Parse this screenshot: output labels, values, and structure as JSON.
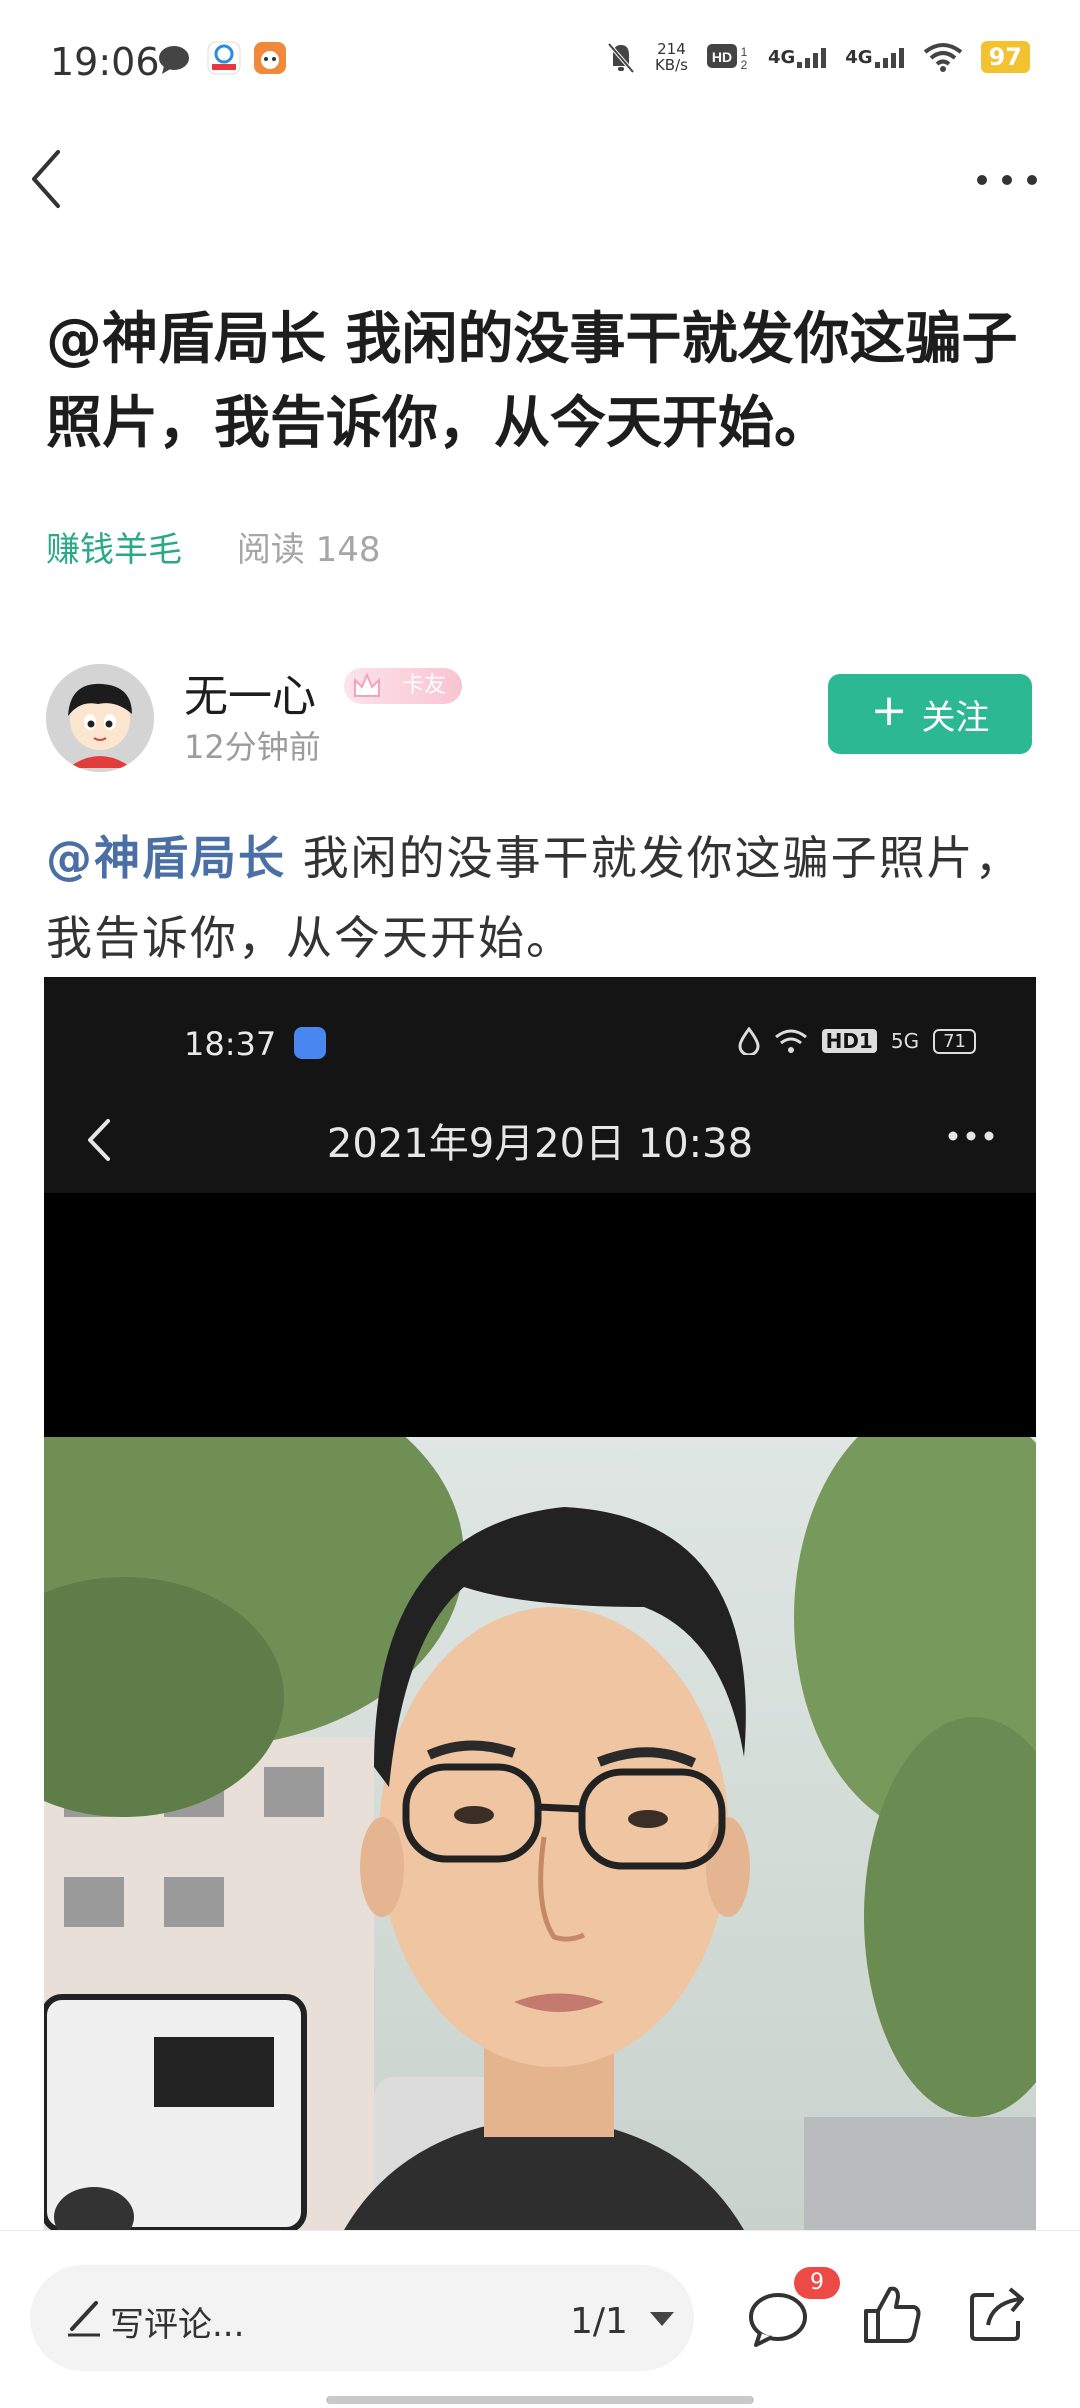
{
  "status_bar": {
    "time": "19:06",
    "network_speed_value": "214",
    "network_speed_unit": "KB/s",
    "hd_label": "HD",
    "network_1": "4G",
    "network_2": "4G",
    "battery": "97"
  },
  "article": {
    "title": "@神盾局长 我闲的没事干就发你这骗子照片，我告诉你，从今天开始。",
    "category": "赚钱羊毛",
    "read_label": "阅读 148"
  },
  "author": {
    "name": "无一心",
    "badge": "卡友",
    "time": "12分钟前",
    "follow_label": "关注"
  },
  "post": {
    "mention": "@神盾局长",
    "text": " 我闲的没事干就发你这骗子照片，我告诉你，从今天开始。"
  },
  "embedded_screenshot": {
    "time": "18:37",
    "hd_label": "HD1",
    "net_label": "5G",
    "battery": "71",
    "date_title": "2021年9月20日 10:38"
  },
  "bottom_bar": {
    "comment_placeholder": "写评论...",
    "page_indicator": "1/1",
    "comment_count": "9"
  },
  "colors": {
    "accent": "#2db894",
    "category": "#2aa987",
    "mention": "#4a6fa5",
    "badge_red": "#ee4a45"
  }
}
